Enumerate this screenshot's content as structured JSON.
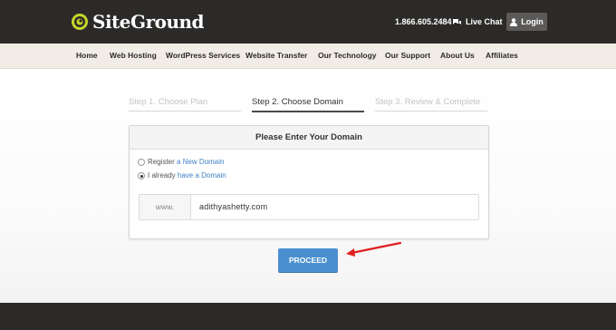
{
  "header": {
    "logo_text": "SiteGround",
    "phone": "1.866.605.2484",
    "live_chat_label": "Live Chat",
    "login_label": "Login"
  },
  "nav": {
    "items": [
      "Home",
      "Web Hosting",
      "WordPress Services",
      "Website Transfer",
      "Our Technology",
      "Our Support",
      "About Us",
      "Affiliates"
    ]
  },
  "steps": [
    {
      "label": "Step 1. Choose Plan",
      "state": "inactive"
    },
    {
      "label": "Step 2. Choose Domain",
      "state": "active"
    },
    {
      "label": "Step 3. Review & Complete",
      "state": "inactive"
    }
  ],
  "domain_form": {
    "title": "Please Enter Your Domain",
    "option_register_prefix": "Register ",
    "option_register_link": "a New Domain",
    "option_existing_prefix": "I already ",
    "option_existing_link": "have a Domain",
    "selected_option": "existing",
    "www_label": "www.",
    "domain_value": "adithyashetty.com"
  },
  "proceed_label": "PROCEED",
  "colors": {
    "header_bg": "#2b2a28",
    "nav_bg": "#f1ece6",
    "accent": "#4a8fd0",
    "link": "#3f82c4",
    "annotation_arrow": "#e02020"
  }
}
